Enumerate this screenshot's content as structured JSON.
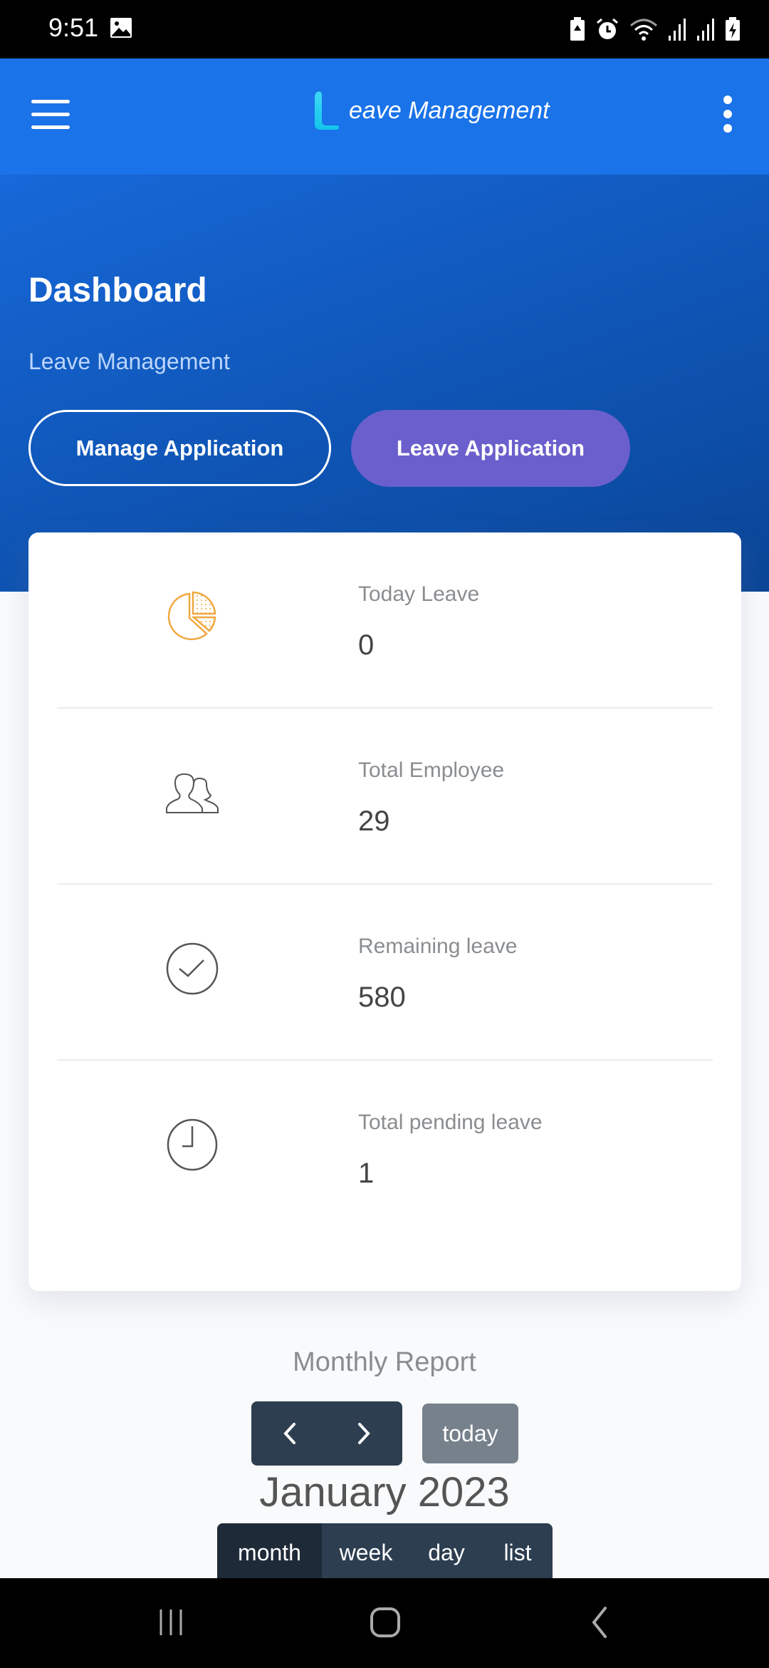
{
  "status_bar": {
    "time": "9:51",
    "icons": [
      "image-notification-icon",
      "battery-saver-icon",
      "alarm-icon",
      "wifi-icon",
      "signal-icon",
      "signal-icon-2",
      "battery-charging-icon"
    ]
  },
  "app_bar": {
    "logo_letter": "L",
    "title": "eave Management",
    "menu_icon": "hamburger-menu-icon",
    "overflow_icon": "more-vertical-icon"
  },
  "hero": {
    "title": "Dashboard",
    "subtitle": "Leave Management",
    "buttons": {
      "manage": "Manage Application",
      "leave": "Leave Application"
    }
  },
  "stats": [
    {
      "label": "Today Leave",
      "value": "0",
      "icon": "pie-chart-icon"
    },
    {
      "label": "Total Employee",
      "value": "29",
      "icon": "users-icon"
    },
    {
      "label": "Remaining leave",
      "value": "580",
      "icon": "check-circle-icon"
    },
    {
      "label": "Total pending leave",
      "value": "1",
      "icon": "clock-icon"
    }
  ],
  "report": {
    "title": "Monthly Report",
    "prev_icon": "chevron-left-icon",
    "next_icon": "chevron-right-icon",
    "today_label": "today",
    "calendar_title": "January 2023",
    "views": [
      "month",
      "week",
      "day",
      "list"
    ],
    "active_view": "month"
  },
  "colors": {
    "app_bar": "#1a73e8",
    "leave_button": "#6a5fcc",
    "pie_icon": "#f0a840",
    "calendar_dark": "#2c3e50"
  }
}
